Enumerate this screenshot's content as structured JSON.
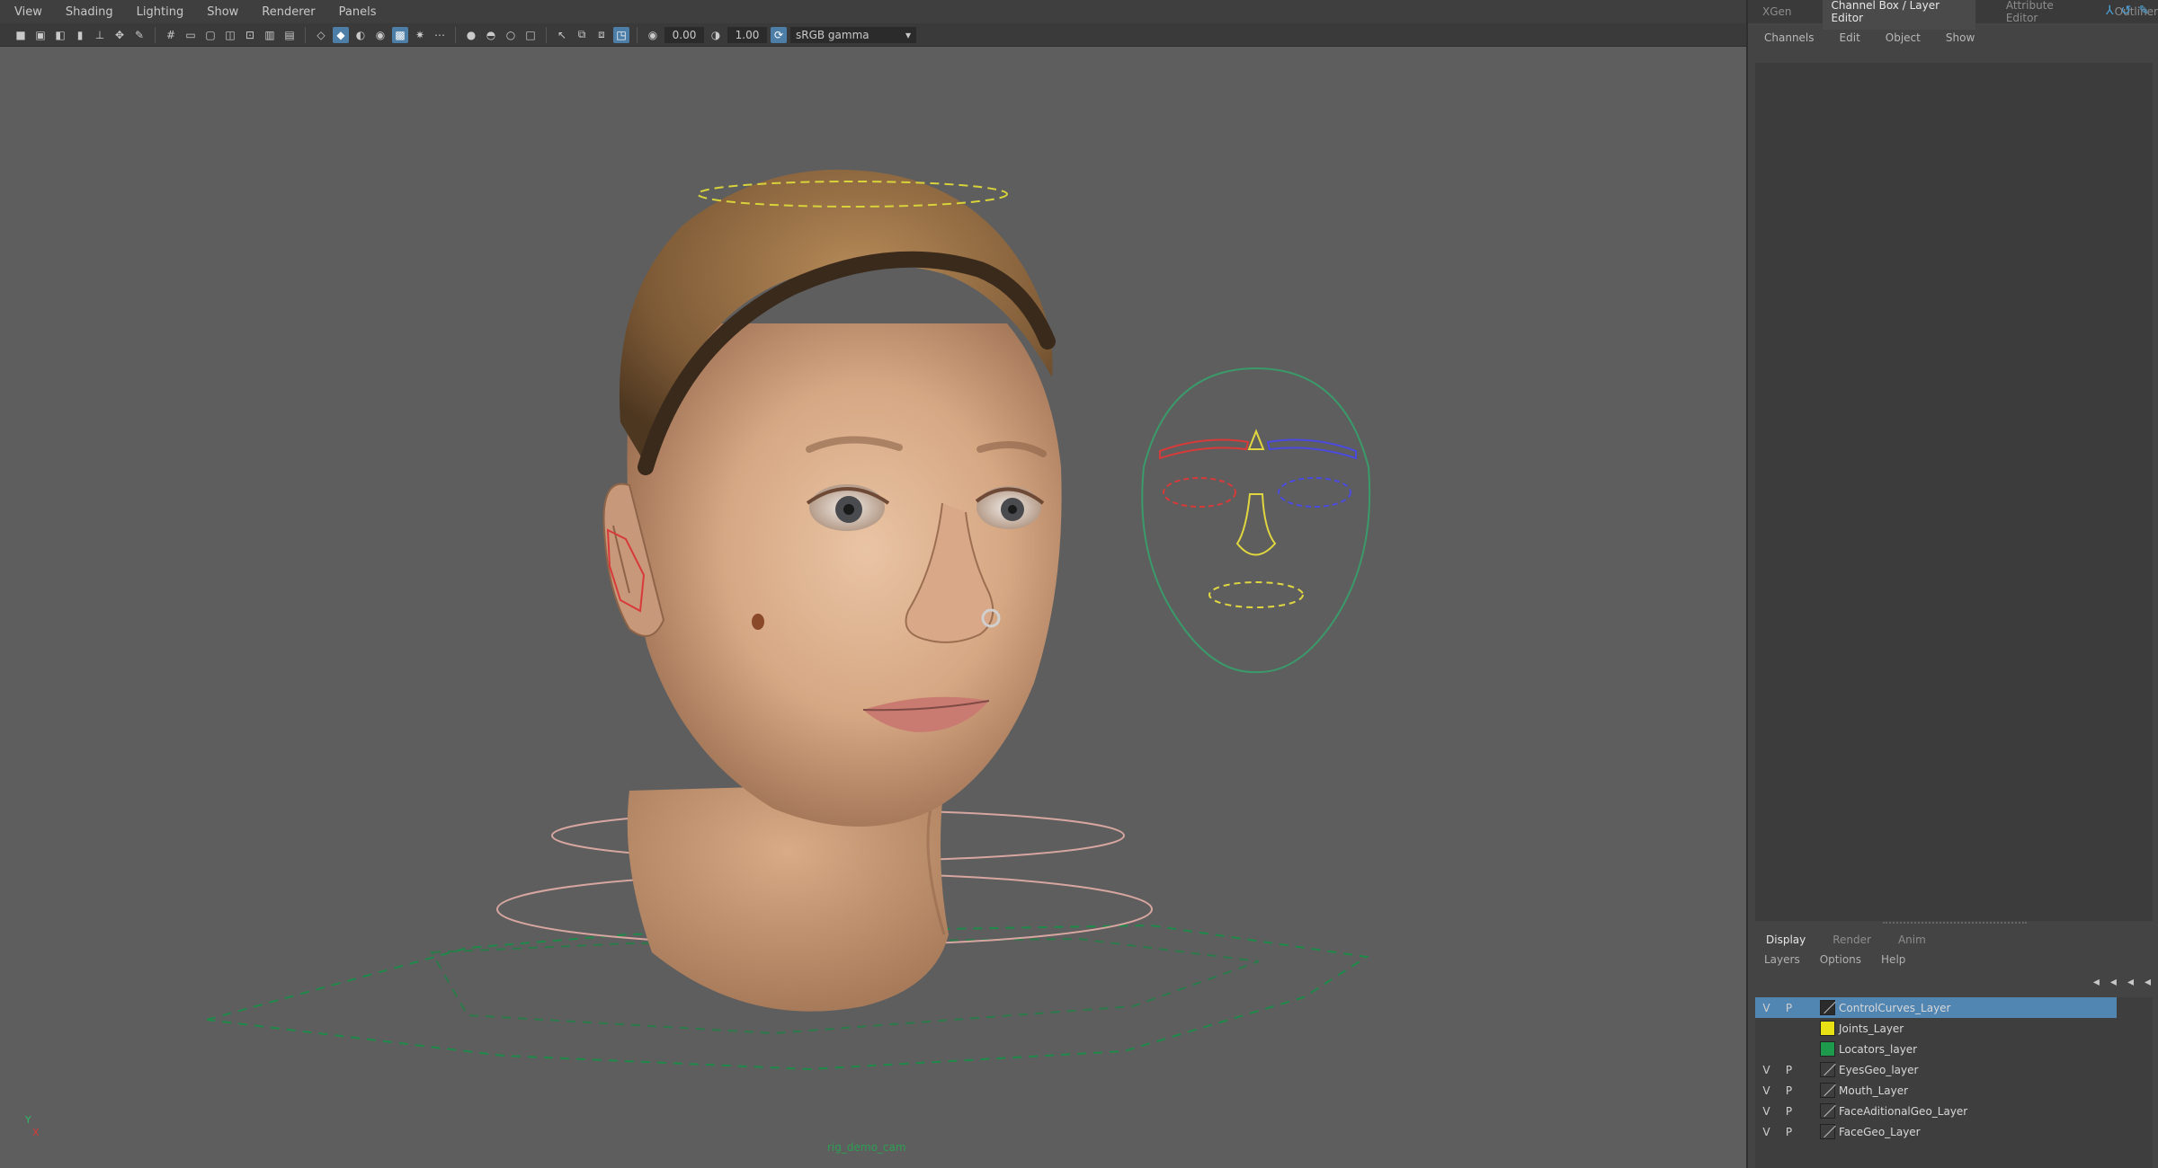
{
  "viewport": {
    "menus": [
      "View",
      "Shading",
      "Lighting",
      "Show",
      "Renderer",
      "Panels"
    ],
    "exposure_value": "0.00",
    "gamma_value": "1.00",
    "color_space": "sRGB gamma",
    "camera_label": "rig_demo_cam",
    "axis_y": "Y",
    "axis_x": "X"
  },
  "panel": {
    "tabs": [
      "XGen",
      "Channel Box / Layer Editor",
      "Attribute Editor",
      "Outliner"
    ],
    "channel_menu": [
      "Channels",
      "Edit",
      "Object",
      "Show"
    ],
    "layer_tabs": [
      "Display",
      "Render",
      "Anim"
    ],
    "layer_menu": [
      "Layers",
      "Options",
      "Help"
    ],
    "layers": [
      {
        "v": "V",
        "p": "P",
        "name": "ControlCurves_Layer",
        "color": "#2b2b2b",
        "selected": true
      },
      {
        "v": "",
        "p": "",
        "name": "Joints_Layer",
        "color": "#e8e214",
        "selected": false
      },
      {
        "v": "",
        "p": "",
        "name": "Locators_layer",
        "color": "#1e9a4c",
        "selected": false
      },
      {
        "v": "V",
        "p": "P",
        "name": "EyesGeo_layer",
        "color": "",
        "selected": false
      },
      {
        "v": "V",
        "p": "P",
        "name": "Mouth_Layer",
        "color": "",
        "selected": false
      },
      {
        "v": "V",
        "p": "P",
        "name": "FaceAditionalGeo_Layer",
        "color": "",
        "selected": false
      },
      {
        "v": "V",
        "p": "P",
        "name": "FaceGeo_Layer",
        "color": "",
        "selected": false
      }
    ]
  }
}
